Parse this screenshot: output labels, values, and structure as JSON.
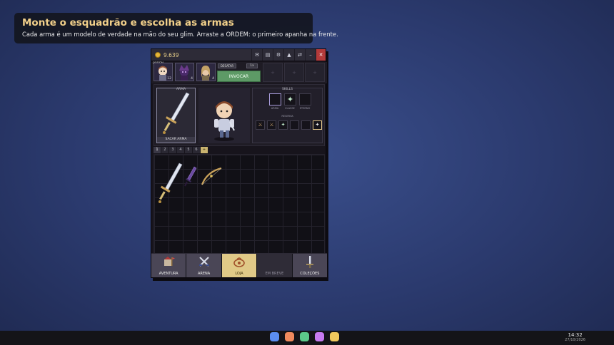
{
  "banner": {
    "title": "Monte o esquadrão e escolha as armas",
    "subtitle": "Cada arma é um modelo de verdade na mão do seu glim. Arraste a ORDEM: o primeiro apanha na frente."
  },
  "window": {
    "gold": "9.639",
    "titlebar_icons": [
      "mail-icon",
      "book-icon",
      "gear-icon",
      "bag-icon",
      "swap-icon",
      "minimize-icon",
      "close-icon"
    ]
  },
  "party": {
    "order_label": "ORDEM",
    "members": [
      {
        "name": "glim-1",
        "level": "12"
      },
      {
        "name": "glim-2",
        "level": "4"
      },
      {
        "name": "glim-3",
        "level": "4"
      }
    ],
    "desatar_label": "DESATAR",
    "speed_label": "1x",
    "summon_label": "INVOCAR"
  },
  "equip": {
    "weapon_header": "ARMA",
    "draw_weapon_label": "SACAR ARMA",
    "skills_title": "SKILLS",
    "skill_labels": [
      "ARMA",
      "CLASSE",
      "ETERNO"
    ],
    "reserve_title": "RESERVA"
  },
  "inventory": {
    "tabs": [
      "1",
      "2",
      "3",
      "4",
      "5",
      "6",
      "+"
    ],
    "active_tab": "1",
    "items": [
      "sword-item",
      "dagger-item",
      "bow-item"
    ]
  },
  "nav": {
    "items": [
      {
        "label": "AVENTURA",
        "state": "normal"
      },
      {
        "label": "ARENA",
        "state": "normal"
      },
      {
        "label": "LOJA",
        "state": "active"
      },
      {
        "label": "EM BREVE",
        "state": "disabled"
      },
      {
        "label": "COLEÇÕES",
        "state": "normal"
      }
    ]
  },
  "taskbar": {
    "dock_colors": [
      "#5b8def",
      "#f08a5d",
      "#5cc98a",
      "#c77bf0",
      "#f0c85d"
    ],
    "time": "14:32",
    "date": "27/10/2026"
  },
  "colors": {
    "accent": "#e0c987",
    "summon": "#5d9a66",
    "close": "#b33a3a"
  }
}
